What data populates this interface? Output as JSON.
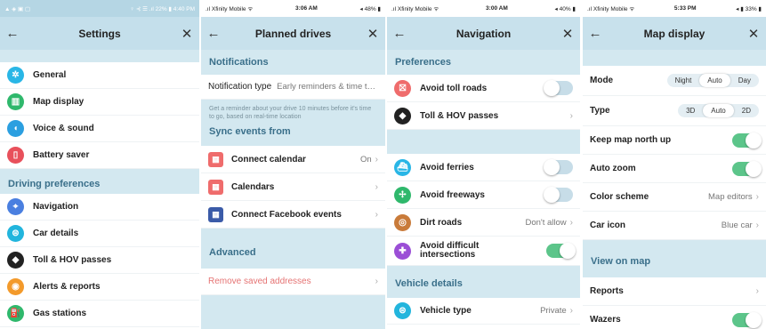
{
  "panel1": {
    "status": {
      "left": "▲ ◈ ▣ ▢",
      "right": "♀ ⊰ ☰ .ıl 22% ▮ 4:40 PM"
    },
    "title": "Settings",
    "items": [
      {
        "label": "General",
        "icon": "gear-icon",
        "color": "#29b6e6"
      },
      {
        "label": "Map display",
        "icon": "map-icon",
        "color": "#2fb86c"
      },
      {
        "label": "Voice & sound",
        "icon": "speaker-icon",
        "color": "#2b9fe0"
      },
      {
        "label": "Battery saver",
        "icon": "battery-icon",
        "color": "#e8505b"
      }
    ],
    "section": "Driving preferences",
    "driving_items": [
      {
        "label": "Navigation",
        "icon": "navigation-icon",
        "color": "#4a7fe0"
      },
      {
        "label": "Car details",
        "icon": "car-icon",
        "color": "#22b5dd"
      },
      {
        "label": "Toll & HOV passes",
        "icon": "toll-icon",
        "color": "#222222"
      },
      {
        "label": "Alerts & reports",
        "icon": "alert-icon",
        "color": "#f39a2b"
      },
      {
        "label": "Gas stations",
        "icon": "gas-icon",
        "color": "#2fb86c"
      }
    ]
  },
  "panel2": {
    "status": {
      "left": ".ıl Xfinity Mobile ᯤ",
      "mid": "3:06 AM",
      "right": "◂ 48% ▮"
    },
    "title": "Planned drives",
    "notifications_header": "Notifications",
    "notification_type_label": "Notification type",
    "notification_type_value": "Early reminders & time to...",
    "note": "Get a reminder about your drive 10 minutes before it's time to go, based on real-time location",
    "sync_header": "Sync events from",
    "sync_items": [
      {
        "label": "Connect calendar",
        "value": "On",
        "icon": "calendar-icon",
        "color": "#ef6c6c"
      },
      {
        "label": "Calendars",
        "value": "",
        "icon": "calendar-icon",
        "color": "#ef6c6c"
      },
      {
        "label": "Connect Facebook events",
        "value": "",
        "icon": "facebook-icon",
        "color": "#3b5ba8"
      }
    ],
    "advanced_header": "Advanced",
    "remove_label": "Remove saved addresses"
  },
  "panel3": {
    "status": {
      "left": ".ıl Xfinity Mobile ᯤ",
      "mid": "3:00 AM",
      "right": "◂ 40% ▮"
    },
    "title": "Navigation",
    "preferences_header": "Preferences",
    "avoid_toll": "Avoid toll roads",
    "toll_hov": "Toll & HOV passes",
    "avoid_ferries": "Avoid ferries",
    "avoid_freeways": "Avoid freeways",
    "dirt_roads": "Dirt roads",
    "dirt_value": "Don't allow",
    "avoid_difficult": "Avoid difficult intersections",
    "vehicle_header": "Vehicle details",
    "vehicle_type": "Vehicle type",
    "vehicle_value": "Private"
  },
  "panel4": {
    "status": {
      "left": ".ıl Xfinity Mobile ᯤ",
      "mid": "5:33 PM",
      "right": "◂ ▮ 33% ▮"
    },
    "title": "Map display",
    "mode_label": "Mode",
    "mode_options": [
      "Night",
      "Auto",
      "Day"
    ],
    "type_label": "Type",
    "type_options": [
      "3D",
      "Auto",
      "2D"
    ],
    "north_label": "Keep map north up",
    "zoom_label": "Auto zoom",
    "color_label": "Color scheme",
    "color_value": "Map editors",
    "car_label": "Car icon",
    "car_value": "Blue car",
    "view_header": "View on map",
    "reports_label": "Reports",
    "wazers_label": "Wazers"
  },
  "icons": {
    "back": "←",
    "close": "✕",
    "chevron": "›"
  }
}
